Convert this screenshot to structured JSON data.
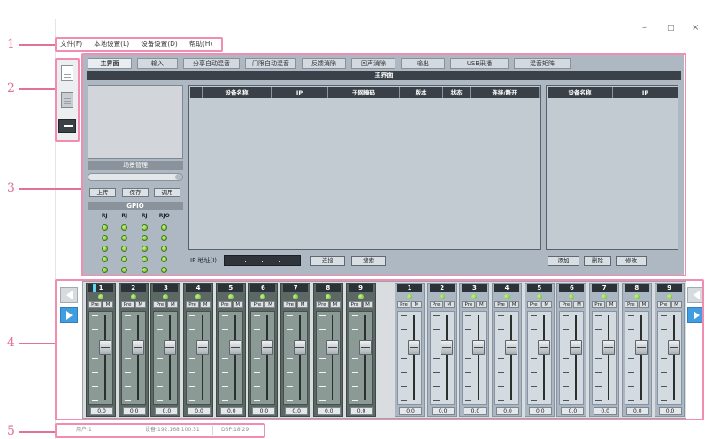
{
  "window": {
    "minimize": "–",
    "maximize": "□",
    "close": "×"
  },
  "annotations": [
    {
      "label": "1"
    },
    {
      "label": "2"
    },
    {
      "label": "3"
    },
    {
      "label": "4"
    },
    {
      "label": "5"
    }
  ],
  "menu": [
    {
      "label": "文件(F)"
    },
    {
      "label": "本地设置(L)"
    },
    {
      "label": "设备设置(D)"
    },
    {
      "label": "帮助(H)"
    }
  ],
  "toolbar": [
    {
      "icon": "new-document-icon"
    },
    {
      "icon": "document-icon"
    },
    {
      "icon": "dark-toggle-icon"
    }
  ],
  "tabs": [
    {
      "label": "主界面",
      "active": true
    },
    {
      "label": "输入"
    },
    {
      "label": "分享自动混音"
    },
    {
      "label": "门限自动混音"
    },
    {
      "label": "反馈消除"
    },
    {
      "label": "回声消除"
    },
    {
      "label": "输出"
    },
    {
      "label": "USB采播"
    },
    {
      "label": "混音矩阵"
    }
  ],
  "main": {
    "header": "主界面",
    "scene": {
      "title": "场景管理",
      "buttons": {
        "upload": "上传",
        "save": "保存",
        "recall": "调用"
      }
    },
    "gpio": {
      "title": "GPIO",
      "columns": [
        "RJ",
        "RJ",
        "RJ",
        "RJO"
      ],
      "leds": [
        [
          1,
          1,
          1,
          1
        ],
        [
          1,
          1,
          1,
          1
        ],
        [
          1,
          1,
          1,
          1
        ],
        [
          1,
          1,
          1,
          1
        ],
        [
          1,
          1,
          1,
          1
        ]
      ]
    },
    "device_table": {
      "columns": [
        "",
        "设备名称",
        "IP",
        "子网掩码",
        "版本",
        "状态",
        "连接/断开"
      ],
      "rows": []
    },
    "saved_table": {
      "columns": [
        "设备名称",
        "IP"
      ],
      "rows": []
    },
    "ip_label": "IP 地址(I)",
    "ip_value": ". . .",
    "buttons": {
      "connect": "连接",
      "search": "搜索",
      "add": "添加",
      "delete": "删除",
      "edit": "修改"
    }
  },
  "mixer": {
    "pre_label": "Pre",
    "mute_label": "M",
    "inputs": [
      {
        "number": "1",
        "value": "0.0",
        "selected": true
      },
      {
        "number": "2",
        "value": "0.0"
      },
      {
        "number": "3",
        "value": "0.0"
      },
      {
        "number": "4",
        "value": "0.0"
      },
      {
        "number": "5",
        "value": "0.0"
      },
      {
        "number": "6",
        "value": "0.0"
      },
      {
        "number": "7",
        "value": "0.0"
      },
      {
        "number": "8",
        "value": "0.0"
      },
      {
        "number": "9",
        "value": "0.0"
      }
    ],
    "outputs": [
      {
        "number": "1",
        "value": "0.0"
      },
      {
        "number": "2",
        "value": "0.0"
      },
      {
        "number": "3",
        "value": "0.0"
      },
      {
        "number": "4",
        "value": "0.0"
      },
      {
        "number": "5",
        "value": "0.0"
      },
      {
        "number": "6",
        "value": "0.0"
      },
      {
        "number": "7",
        "value": "0.0"
      },
      {
        "number": "8",
        "value": "0.0"
      },
      {
        "number": "9",
        "value": "0.0"
      }
    ]
  },
  "status": {
    "user": "用户:1",
    "device": "设备:192.168.100.51",
    "dsp": "DSP:18.29"
  },
  "colors": {
    "annotation": "#e0729b",
    "annotation_box": "#f08db0",
    "led_on": "#5dae22",
    "nav_arrow_active": "#3f9de0",
    "header_dark": "#3b4148"
  }
}
